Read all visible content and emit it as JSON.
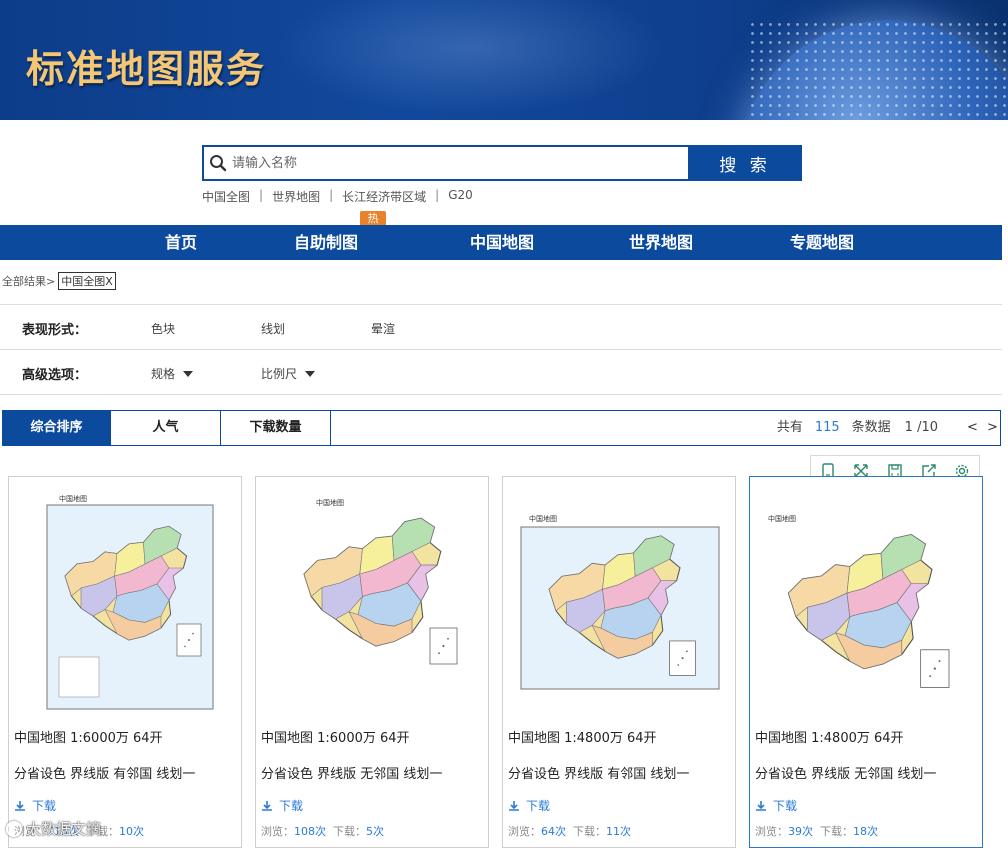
{
  "banner": {
    "title": "标准地图服务"
  },
  "search": {
    "placeholder": "请输入名称",
    "button_label": "搜 索"
  },
  "quick_links": [
    "中国全图",
    "世界地图",
    "长江经济带区域",
    "G20"
  ],
  "nav": {
    "items": [
      "首页",
      "自助制图",
      "中国地图",
      "世界地图",
      "专题地图"
    ],
    "hot_badge": "热"
  },
  "breadcrumb": {
    "root": "全部结果>",
    "tag": "中国全图X"
  },
  "filters": {
    "style": {
      "label": "表现形式：",
      "options": [
        "色块",
        "线划",
        "晕渲"
      ]
    },
    "advanced": {
      "label": "高级选项：",
      "options": [
        "规格",
        "比例尺"
      ]
    }
  },
  "sort": {
    "tabs": [
      "综合排序",
      "人气",
      "下载数量"
    ],
    "total_prefix": "共有",
    "total": "115",
    "total_suffix": "条数据",
    "page": "1 /10",
    "prev": "<",
    "next": ">"
  },
  "card_tools": [
    "phone-icon",
    "expand-icon",
    "save-icon",
    "share-icon",
    "gear-icon"
  ],
  "cards": [
    {
      "title": "中国地图 1:6000万 64开",
      "desc": "分省设色 界线版 有邻国 线划一",
      "download": "下载",
      "views_label": "浏览：",
      "views": "713次",
      "downloads_label": "下载：",
      "downloads": "10次",
      "map_caption": "中国地图"
    },
    {
      "title": "中国地图 1:6000万 64开",
      "desc": "分省设色 界线版 无邻国 线划一",
      "download": "下载",
      "views_label": "浏览：",
      "views": "108次",
      "downloads_label": "下载：",
      "downloads": "5次",
      "map_caption": "中国地图"
    },
    {
      "title": "中国地图 1:4800万 64开",
      "desc": "分省设色 界线版 有邻国 线划一",
      "download": "下载",
      "views_label": "浏览：",
      "views": "64次",
      "downloads_label": "下载：",
      "downloads": "11次",
      "map_caption": "中国地图"
    },
    {
      "title": "中国地图 1:4800万 64开",
      "desc": "分省设色 界线版 无邻国 线划一",
      "download": "下载",
      "views_label": "浏览：",
      "views": "39次",
      "downloads_label": "下载：",
      "downloads": "18次",
      "map_caption": "中国地图"
    }
  ],
  "watermark": "大数据文摘",
  "colors": {
    "primary": "#0c4a9e",
    "link": "#2b7bd6",
    "hot": "#e9832b",
    "banner_title": "#f3c776"
  }
}
